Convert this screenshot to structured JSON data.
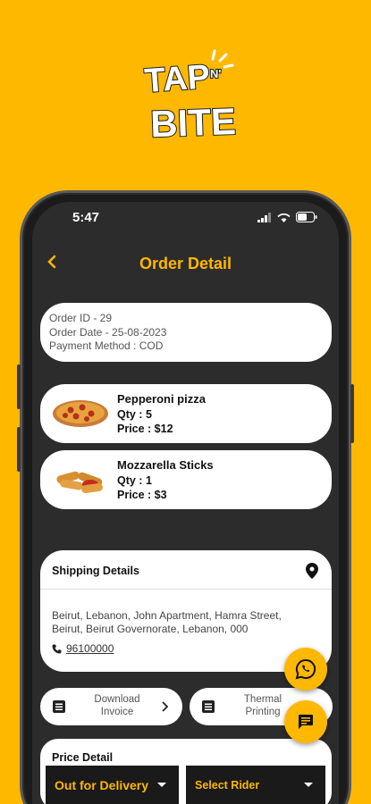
{
  "status": {
    "time": "5:47"
  },
  "header": {
    "title": "Order Detail"
  },
  "order": {
    "id_line": "Order ID - 29",
    "date_line": "Order Date - 25-08-2023",
    "payment_line": "Payment Method : COD"
  },
  "items": [
    {
      "name": "Pepperoni pizza",
      "qty": "Qty : 5",
      "price": "Price : $12"
    },
    {
      "name": "Mozzarella Sticks",
      "qty": "Qty : 1",
      "price": "Price : $3"
    }
  ],
  "shipping": {
    "title": "Shipping Details",
    "address": "Beirut, Lebanon, John Apartment, Hamra Street, Beirut, Beirut Governorate, Lebanon, 000",
    "phone": "96100000"
  },
  "actions": {
    "download": "Download Invoice",
    "thermal": "Thermal Printing"
  },
  "price": {
    "title": "Price Detail"
  },
  "bottom": {
    "status_value": "Out for Delivery",
    "rider_value": "Select Rider"
  },
  "colors": {
    "accent": "#FFB800",
    "background": "#2C2C2C"
  },
  "logo_text": "TAP N' BITE"
}
